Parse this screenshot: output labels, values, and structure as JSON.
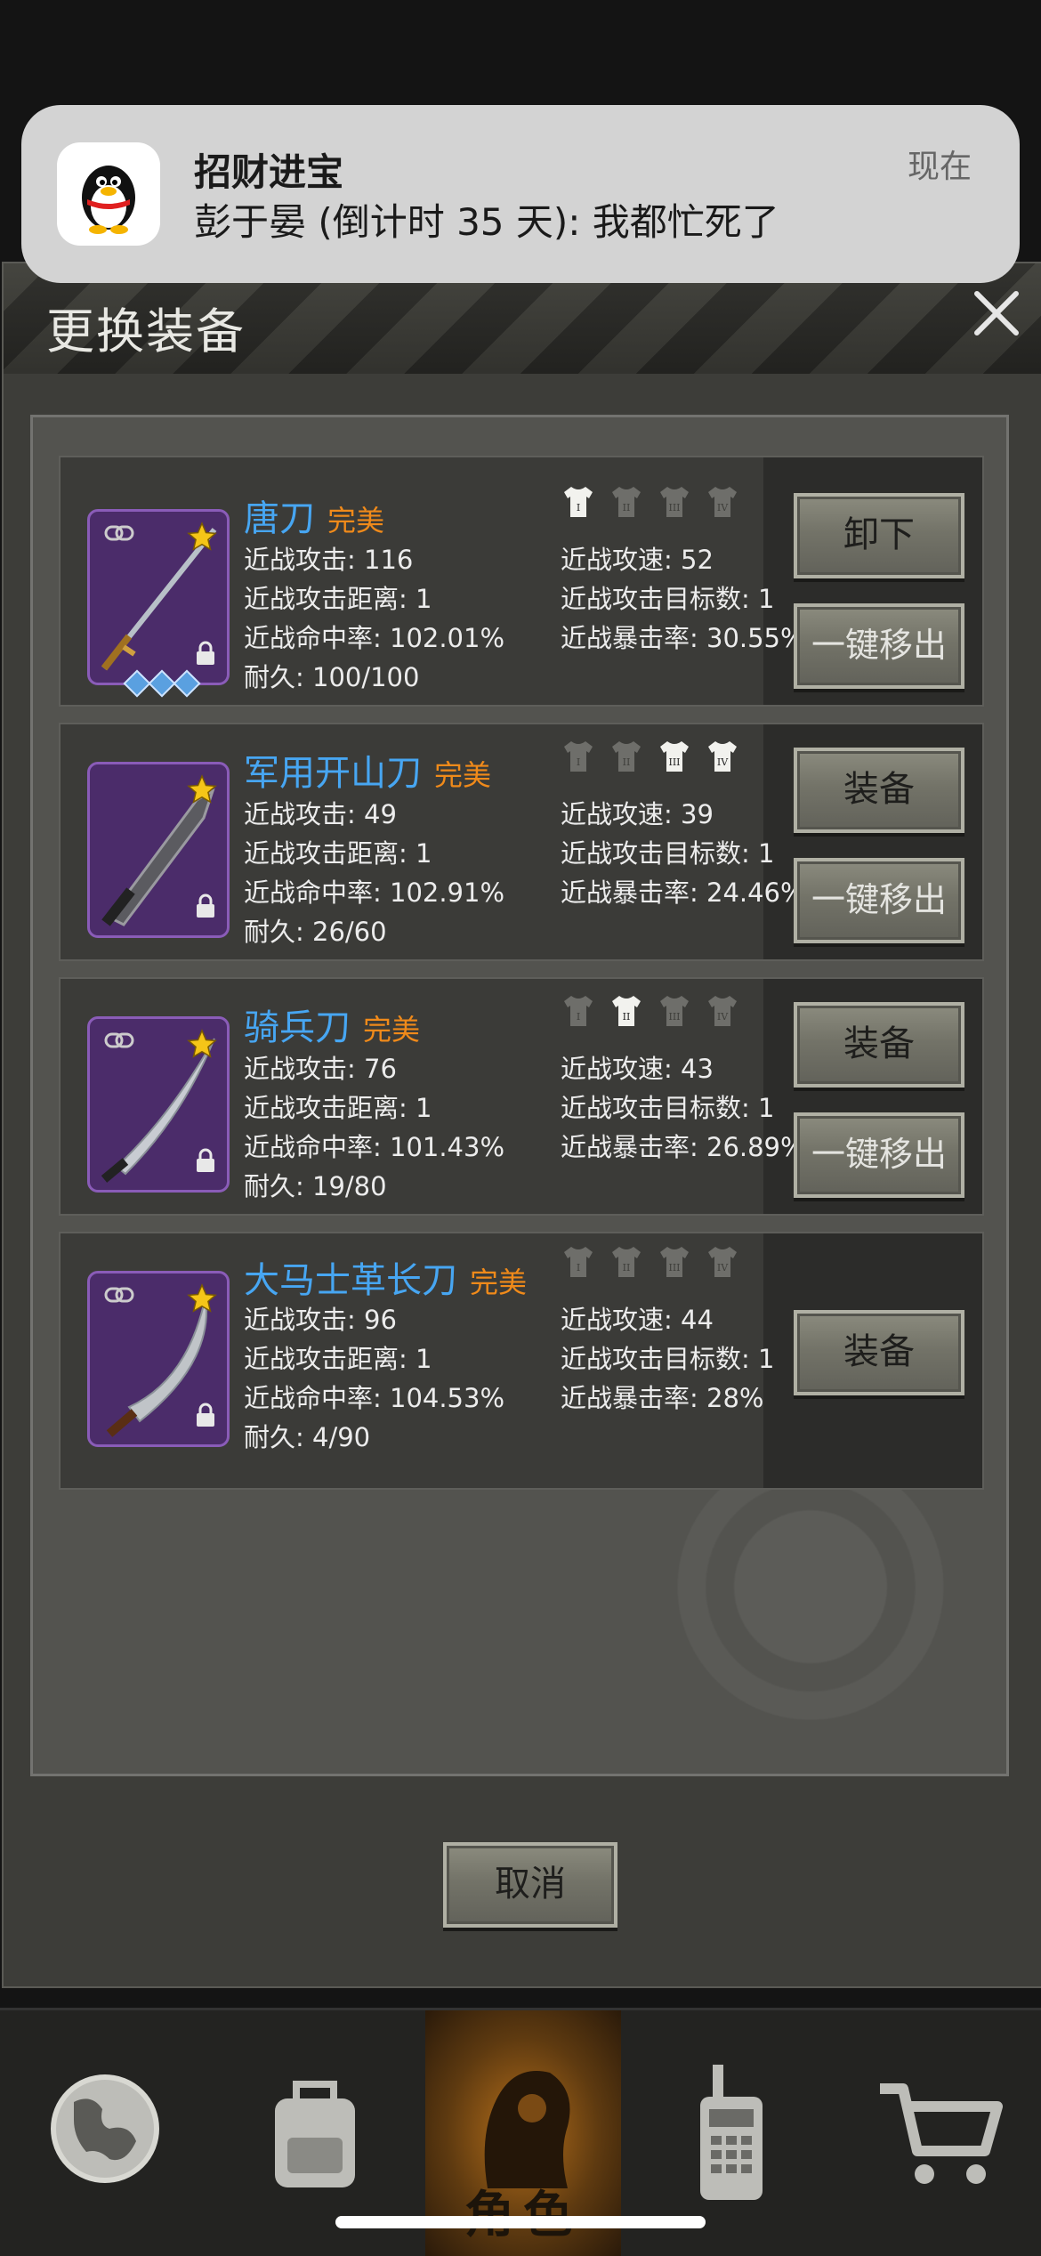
{
  "notification": {
    "app": "招财进宝",
    "message": "彭于晏 (倒计时 35 天): 我都忙死了",
    "time": "现在",
    "icon": "qq-penguin-icon"
  },
  "dialog": {
    "title": "更换装备",
    "cancel_label": "取消"
  },
  "items": [
    {
      "name": "唐刀",
      "quality": "完美",
      "atk": "近战攻击: 116",
      "spd": "近战攻速: 52",
      "range": "近战攻击距离: 1",
      "targets": "近战攻击目标数: 1",
      "hit": "近战命中率: 102.01%",
      "crit": "近战暴击率: 30.55%",
      "dur": "耐久: 100/100",
      "buttons": [
        "卸下",
        "一键移出"
      ],
      "slots": [
        true,
        false,
        false,
        false
      ],
      "gems": 3
    },
    {
      "name": "军用开山刀",
      "quality": "完美",
      "atk": "近战攻击: 49",
      "spd": "近战攻速: 39",
      "range": "近战攻击距离: 1",
      "targets": "近战攻击目标数: 1",
      "hit": "近战命中率: 102.91%",
      "crit": "近战暴击率: 24.46%",
      "dur": "耐久: 26/60",
      "buttons": [
        "装备",
        "一键移出"
      ],
      "slots": [
        false,
        false,
        true,
        true
      ]
    },
    {
      "name": "骑兵刀",
      "quality": "完美",
      "atk": "近战攻击: 76",
      "spd": "近战攻速: 43",
      "range": "近战攻击距离: 1",
      "targets": "近战攻击目标数: 1",
      "hit": "近战命中率: 101.43%",
      "crit": "近战暴击率: 26.89%",
      "dur": "耐久: 19/80",
      "buttons": [
        "装备",
        "一键移出"
      ],
      "slots": [
        false,
        true,
        false,
        false
      ]
    },
    {
      "name": "大马士革长刀",
      "quality": "完美",
      "atk": "近战攻击: 96",
      "spd": "近战攻速: 44",
      "range": "近战攻击距离: 1",
      "targets": "近战攻击目标数: 1",
      "hit": "近战命中率: 104.53%",
      "crit": "近战暴击率: 28%",
      "dur": "耐久: 4/90",
      "buttons": [
        "装备"
      ],
      "slots": [
        false,
        false,
        false,
        false
      ]
    }
  ],
  "slot_numerals": [
    "I",
    "II",
    "III",
    "IV"
  ],
  "nav": {
    "items": [
      "globe-icon",
      "backpack-icon",
      "character-icon",
      "walkie-talkie-icon",
      "cart-icon"
    ],
    "active_label": "角色"
  },
  "colors": {
    "item_name": "#47a6f2",
    "quality": "#f08a1a",
    "rarity_purple": "#8a5cb8"
  }
}
